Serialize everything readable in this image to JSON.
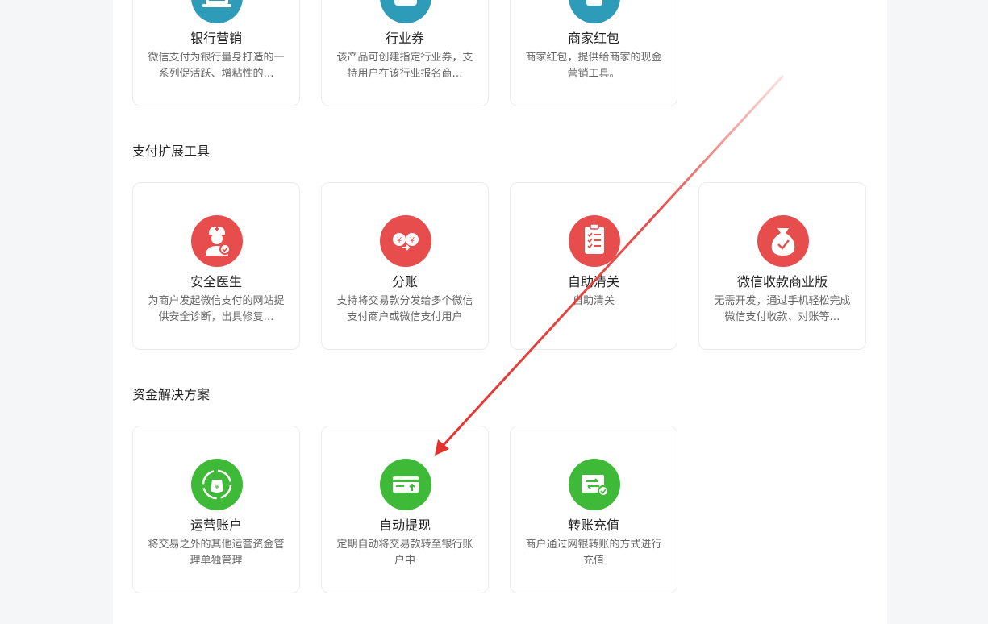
{
  "sections": {
    "payment_tools": {
      "title": "支付扩展工具"
    },
    "fund_solutions": {
      "title": "资金解决方案"
    }
  },
  "top_row": [
    {
      "name": "银行营销",
      "desc": "微信支付为银行量身打造的一系列促活跃、增粘性的…",
      "icon": "bank-icon",
      "color": "#2e9bb8"
    },
    {
      "name": "行业券",
      "desc": "该产品可创建指定行业券，支持用户在该行业报名商…",
      "icon": "coupon-icon",
      "color": "#2e9bb8"
    },
    {
      "name": "商家红包",
      "desc": "商家红包，提供给商家的现金营销工具。",
      "icon": "red-packet-icon",
      "color": "#2e9bb8"
    }
  ],
  "payment_tools_cards": [
    {
      "name": "安全医生",
      "desc": "为商户发起微信支付的网站提供安全诊断，出具修复…",
      "icon": "doctor-icon",
      "color": "#e84d4d"
    },
    {
      "name": "分账",
      "desc": "支持将交易款分发给多个微信支付商户或微信支付用户",
      "icon": "split-yuan-icon",
      "color": "#e84d4d"
    },
    {
      "name": "自助清关",
      "desc": "自助清关",
      "icon": "clipboard-checklist-icon",
      "color": "#e84d4d"
    },
    {
      "name": "微信收款商业版",
      "desc": "无需开发，通过手机轻松完成微信支付收款、对账等…",
      "icon": "money-bag-check-icon",
      "color": "#e84d4d"
    }
  ],
  "fund_cards": [
    {
      "name": "运营账户",
      "desc": "将交易之外的其他运营资金管理单独管理",
      "icon": "money-cycle-icon",
      "color": "#3fb938"
    },
    {
      "name": "自动提现",
      "desc": "定期自动将交易款转至银行账户中",
      "icon": "card-withdraw-icon",
      "color": "#3fb938"
    },
    {
      "name": "转账充值",
      "desc": "商户通过网银转账的方式进行充值",
      "icon": "transfer-card-icon",
      "color": "#3fb938"
    }
  ],
  "annotation": {
    "arrow_color": "#e5322d"
  }
}
